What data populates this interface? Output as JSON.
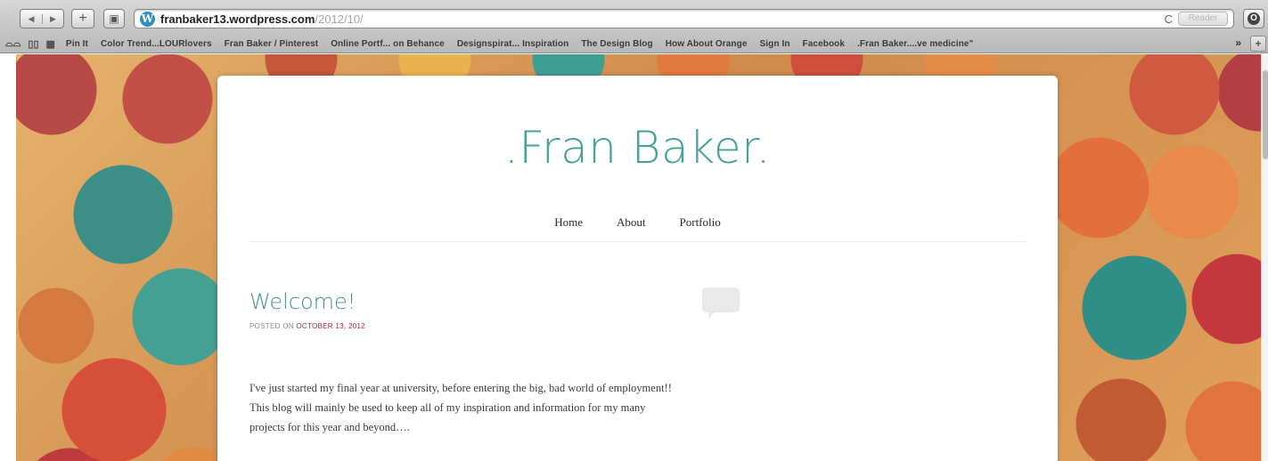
{
  "browser": {
    "url_host": "franbaker13.wordpress.com",
    "url_path": "/2012/10/",
    "reader_label": "Reader",
    "reload_glyph": "C",
    "handwritten_note": "g · p · p  · · ·"
  },
  "bookmarks": {
    "items": [
      "Pin It",
      "Color Trend...LOURlovers",
      "Fran Baker / Pinterest",
      "Online Portf... on Behance",
      "Designspirat... Inspiration",
      "The Design Blog",
      "How About Orange",
      "Sign In",
      "Facebook",
      ".Fran Baker....ve medicine\""
    ],
    "more": "»",
    "add": "+"
  },
  "site": {
    "title": ".Fran Baker.",
    "nav": [
      "Home",
      "About",
      "Portfolio"
    ]
  },
  "post": {
    "title": "Welcome!",
    "meta_prefix": "POSTED ON",
    "date": "OCTOBER 13, 2012",
    "body_lines": [
      "I've just started my final year at university, before entering the big, bad world of employment!!",
      "This blog will mainly be used to keep all of my inspiration and information for my many",
      "projects for this year and beyond…."
    ]
  },
  "colors": {
    "title_teal": "#46a198",
    "date_red": "#b2243a",
    "wordpress_blue": "#2f8fc4"
  }
}
